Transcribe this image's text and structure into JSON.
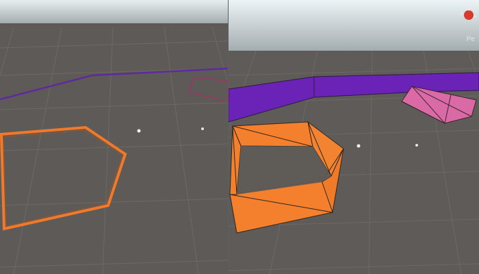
{
  "colors": {
    "sky_top": "#d4e2e6",
    "sky_bottom": "#b9c5c8",
    "ground": "#5f5b58",
    "grid": "#77736f",
    "orange": "#f47f2c",
    "orange_dark": "#a5511d",
    "purple": "#6b27b8",
    "pink": "#d96aa5",
    "edge": "#2f2a2a"
  },
  "left_view": {
    "mode": "wireframe",
    "shapes": [
      "orange-polygon-outline",
      "purple-line",
      "pink-polygon-outline"
    ]
  },
  "right_view": {
    "mode": "filled-mesh",
    "shapes": [
      "orange-extruded-polygon",
      "purple-ribbon",
      "pink-prism"
    ]
  },
  "gizmo": {
    "label": "Pe",
    "icon": "scene-orientation-gizmo-icon"
  }
}
